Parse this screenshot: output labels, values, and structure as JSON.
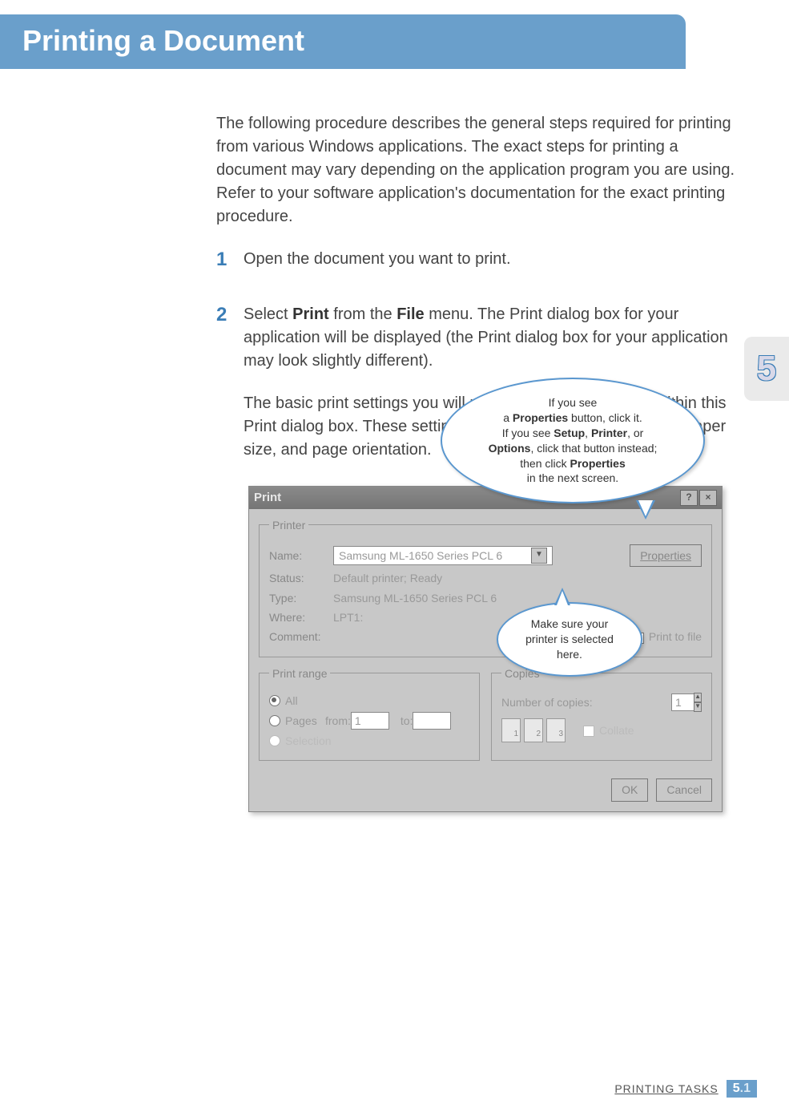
{
  "header": {
    "title": "Printing a Document"
  },
  "side_tab": {
    "chapter_number": "5"
  },
  "intro": "The following procedure describes the general steps required for printing from various Windows applications. The exact steps for printing a document may vary depending on the application program you are using. Refer to your software application's documentation for the exact printing procedure.",
  "steps": {
    "one": {
      "num": "1",
      "text": "Open the document you want to print."
    },
    "two": {
      "num": "2",
      "text_prefix": "Select ",
      "b1": "Print",
      "text_mid1": " from the ",
      "b2": "File",
      "text_suffix": " menu. The Print dialog box for your application will be displayed (the Print dialog box for your application may look slightly different).",
      "para2": "The basic print settings you will need are usually selected within this Print dialog box. These settings include the number of copies, paper size, and page orientation."
    }
  },
  "callouts": {
    "top": {
      "l1": "If you see",
      "l2_pre": "a ",
      "l2_b": "Properties",
      "l2_post": " button, click it.",
      "l3_pre": "If you see ",
      "l3_b1": "Setup",
      "l3_c1": ", ",
      "l3_b2": "Printer",
      "l3_c2": ", or",
      "l4_b": "Options",
      "l4_post": ", click that button instead;",
      "l5_pre": "then click ",
      "l5_b": "Properties",
      "l6": "in the next screen."
    },
    "mid": {
      "l1": "Make sure your",
      "l2": "printer is selected",
      "l3": "here."
    }
  },
  "dialog": {
    "title": "Print",
    "help_btn": "?",
    "close_btn": "×",
    "printer_group": "Printer",
    "name_label": "Name:",
    "name_value": "Samsung ML-1650 Series PCL 6",
    "properties_btn": "Properties",
    "status_label": "Status:",
    "status_value": "Default printer; Ready",
    "type_label": "Type:",
    "type_value": "Samsung ML-1650 Series PCL 6",
    "where_label": "Where:",
    "where_value": "LPT1:",
    "comment_label": "Comment:",
    "print_to_file": "Print to file",
    "range_group": "Print range",
    "all_label": "All",
    "pages_label": "Pages",
    "from_label": "from:",
    "from_value": "1",
    "to_label": "to:",
    "selection_label": "Selection",
    "copies_group": "Copies",
    "num_copies_label": "Number of copies:",
    "num_copies_value": "1",
    "collate_label": "Collate",
    "pg1": "1",
    "pg2": "2",
    "pg3": "3",
    "ok_btn": "OK",
    "cancel_btn": "Cancel"
  },
  "footer": {
    "section": "PRINTING TASKS",
    "page_major": "5",
    "page_dot": ".",
    "page_minor": "1"
  }
}
